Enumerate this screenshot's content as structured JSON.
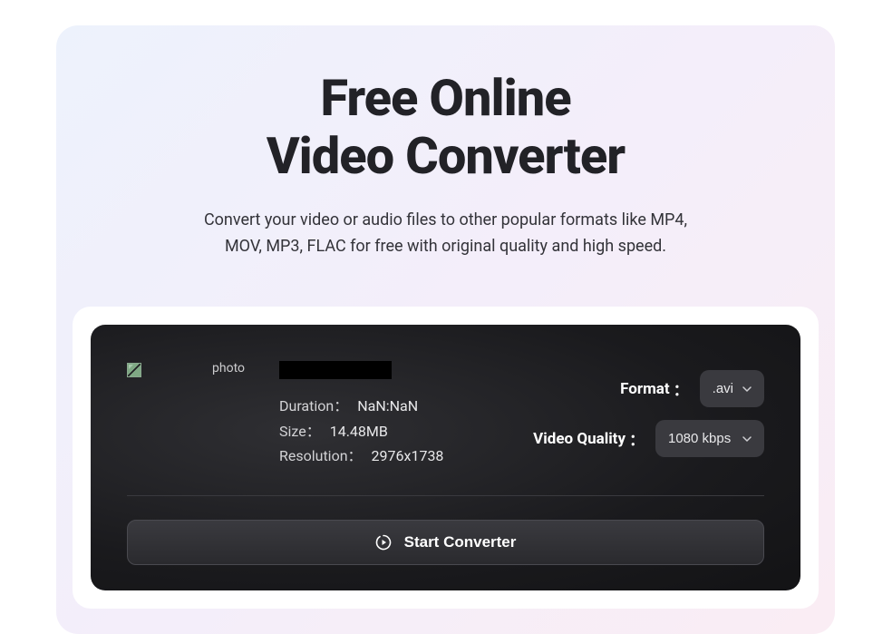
{
  "header": {
    "title_line1": "Free Online",
    "title_line2": "Video Converter",
    "subtitle": "Convert your video or audio files to other popular formats like MP4, MOV, MP3, FLAC for free with original quality and high speed."
  },
  "file": {
    "thumb_alt": "photo",
    "meta": {
      "duration_label": "Duration",
      "duration_value": "NaN:NaN",
      "size_label": "Size",
      "size_value": "14.48MB",
      "resolution_label": "Resolution",
      "resolution_value": "2976x1738"
    }
  },
  "options": {
    "format_label": "Format",
    "format_value": ".avi",
    "quality_label": "Video Quality",
    "quality_value": "1080 kbps"
  },
  "actions": {
    "start_label": "Start Converter"
  }
}
